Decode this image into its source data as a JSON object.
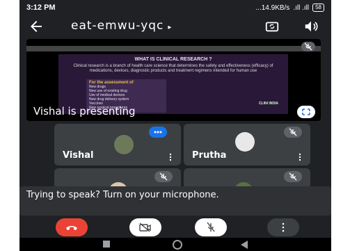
{
  "status": {
    "time": "3:12 PM",
    "network": "...14.9KB/s",
    "signal": ".ıll .ıll",
    "battery": "58"
  },
  "meeting": {
    "code": "eat-emwu-yqc",
    "caret": "▸"
  },
  "presentation": {
    "label": "Vishal is presenting",
    "slide": {
      "title": "WHAT IS CLINICAL RESEARCH ?",
      "text": "Clinical research is a branch of health care science that determines the safety and effectiveness (efficacy) of medications, devices, diagnostic products and treatment regimens intended for human use",
      "bullet_head": "For the assessment of",
      "bullets": [
        "New drugs",
        "New use of existing drug",
        "Use of medical devices",
        "New drug delivery system",
        "Vaccines",
        "New surgical procedures"
      ],
      "brand": "CLINI INDIA"
    }
  },
  "participants": [
    {
      "name": "Vishal"
    },
    {
      "name": "Prutha"
    }
  ],
  "toast": {
    "message": "Trying to speak? Turn on your microphone."
  },
  "icons": {
    "back": "arrow-left-icon",
    "switch_camera": "camera-switch-icon",
    "speaker": "speaker-icon",
    "mic_off": "mic-off-icon",
    "cam_off": "camera-off-icon",
    "end_call": "phone-hangup-icon",
    "more": "more-vert-icon",
    "fullscreen": "fullscreen-icon"
  },
  "colors": {
    "background": "#202124",
    "tile": "#3c4043",
    "end_call": "#ea4335",
    "active_speaker": "#1a73e8"
  }
}
